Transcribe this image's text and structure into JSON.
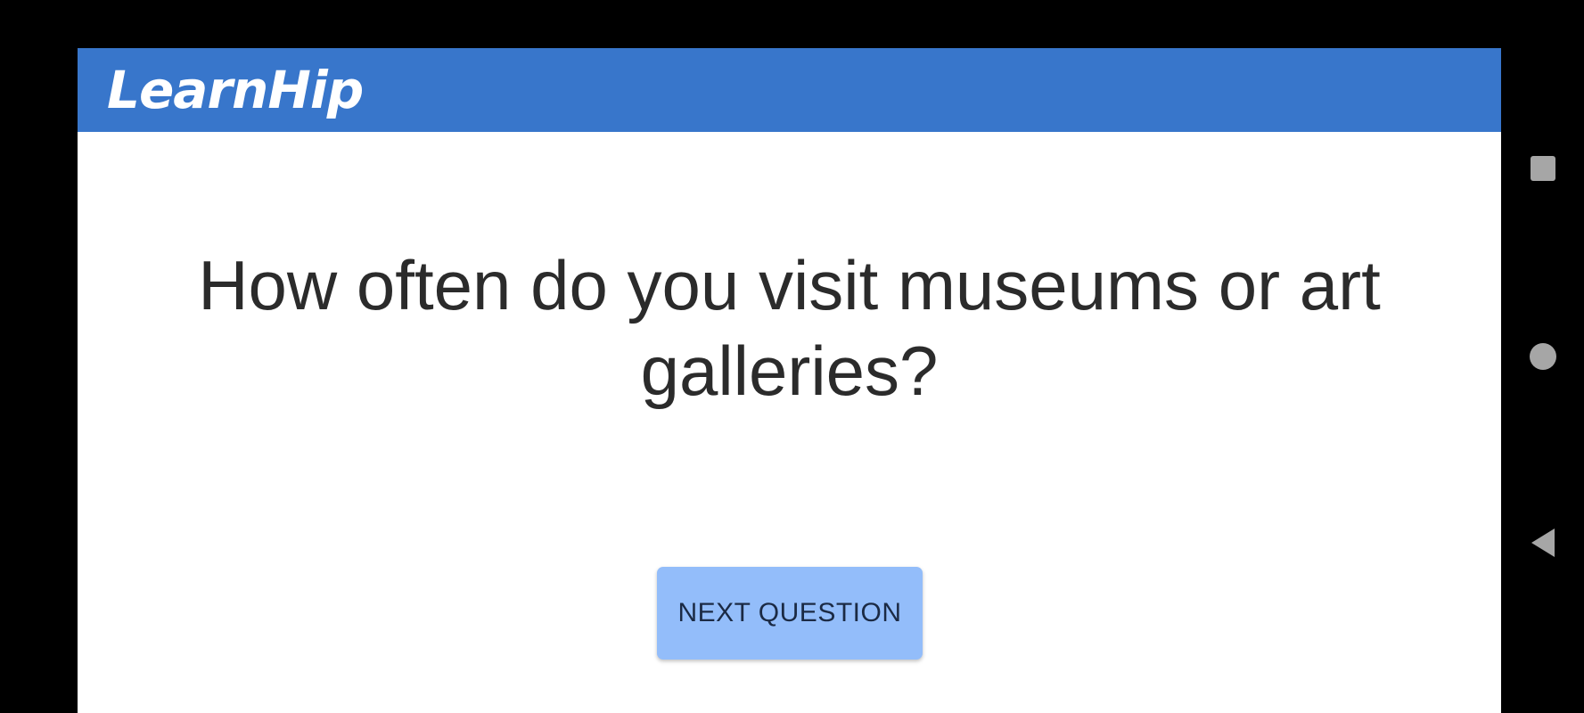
{
  "app": {
    "title": "LearnHip"
  },
  "main": {
    "question": "How often do you visit museums or art galleries?",
    "next_button_label": "NEXT QUESTION"
  },
  "navigation_bar": {
    "buttons": [
      "recents-icon",
      "home-icon",
      "back-icon"
    ]
  },
  "colors": {
    "app_bar": "#3876cb",
    "button": "#93bdfa",
    "background": "#ffffff",
    "system_bars": "#000000",
    "nav_icons": "#a6a6a6"
  }
}
